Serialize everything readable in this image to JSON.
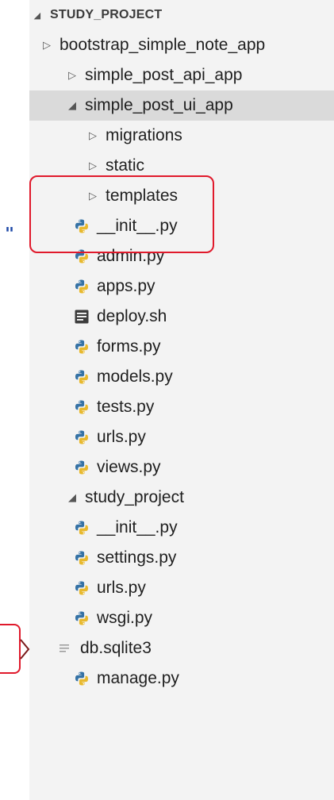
{
  "colors": {
    "sidebar_bg": "#f3f3f3",
    "selected_bg": "#dadada",
    "python_blue": "#3572A5",
    "python_yellow": "#E8B92E",
    "annotation_red": "#e0192b"
  },
  "annotation": {
    "quote_mark": "\""
  },
  "tree": [
    {
      "label": "STUDY_PROJECT",
      "type": "root",
      "expanded": true,
      "icon": "caret-down-icon"
    },
    {
      "label": "bootstrap_simple_note_app",
      "type": "folder",
      "expanded": false,
      "icon": "caret-right-icon"
    },
    {
      "label": "simple_post_api_app",
      "type": "folder",
      "expanded": false,
      "icon": "caret-right-icon"
    },
    {
      "label": "simple_post_ui_app",
      "type": "folder",
      "expanded": true,
      "selected": true,
      "icon": "caret-down-icon"
    },
    {
      "label": "migrations",
      "type": "folder",
      "expanded": false,
      "icon": "caret-right-icon"
    },
    {
      "label": "static",
      "type": "folder",
      "expanded": false,
      "icon": "caret-right-icon"
    },
    {
      "label": "templates",
      "type": "folder",
      "expanded": false,
      "icon": "caret-right-icon"
    },
    {
      "label": "__init__.py",
      "type": "py",
      "icon": "python-icon"
    },
    {
      "label": "admin.py",
      "type": "py",
      "icon": "python-icon"
    },
    {
      "label": "apps.py",
      "type": "py",
      "icon": "python-icon"
    },
    {
      "label": "deploy.sh",
      "type": "sh",
      "icon": "shell-script-icon"
    },
    {
      "label": "forms.py",
      "type": "py",
      "icon": "python-icon"
    },
    {
      "label": "models.py",
      "type": "py",
      "icon": "python-icon"
    },
    {
      "label": "tests.py",
      "type": "py",
      "icon": "python-icon"
    },
    {
      "label": "urls.py",
      "type": "py",
      "icon": "python-icon"
    },
    {
      "label": "views.py",
      "type": "py",
      "icon": "python-icon"
    },
    {
      "label": "study_project",
      "type": "folder",
      "expanded": true,
      "icon": "caret-down-icon"
    },
    {
      "label": "__init__.py",
      "type": "py",
      "icon": "python-icon"
    },
    {
      "label": "settings.py",
      "type": "py",
      "icon": "python-icon"
    },
    {
      "label": "urls.py",
      "type": "py",
      "icon": "python-icon"
    },
    {
      "label": "wsgi.py",
      "type": "py",
      "icon": "python-icon"
    },
    {
      "label": "db.sqlite3",
      "type": "db",
      "icon": "text-file-icon"
    },
    {
      "label": "manage.py",
      "type": "py",
      "icon": "python-icon"
    }
  ]
}
